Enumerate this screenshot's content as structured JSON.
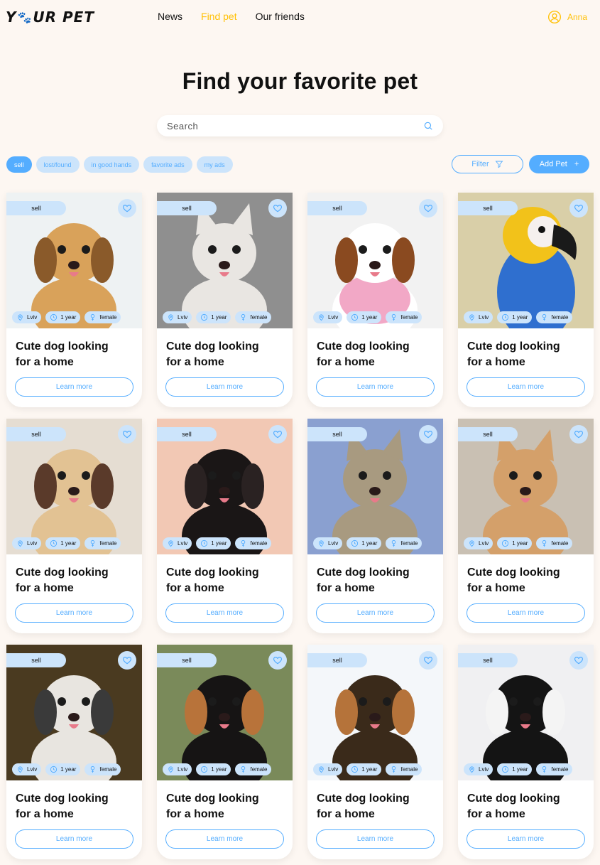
{
  "header": {
    "logo": {
      "pre": "Y",
      "post": "UR PET"
    },
    "nav": [
      {
        "label": "News",
        "active": false
      },
      {
        "label": "Find pet",
        "active": true
      },
      {
        "label": "Our friends",
        "active": false
      }
    ],
    "user_name": "Anna"
  },
  "page_title": "Find your favorite pet",
  "search": {
    "placeholder": "Search",
    "value": ""
  },
  "chips": [
    {
      "label": "sell",
      "active": true
    },
    {
      "label": "lost/found",
      "active": false
    },
    {
      "label": "in good hands",
      "active": false
    },
    {
      "label": "favorite ads",
      "active": false
    },
    {
      "label": "my ads",
      "active": false
    }
  ],
  "actions": {
    "filter_label": "Filter",
    "add_pet_label": "Add Pet",
    "add_icon": "+"
  },
  "colors": {
    "accent_blue": "#54adff",
    "light_blue": "#cce4fb",
    "accent_yellow": "#ffc107",
    "background": "#fdf7f2"
  },
  "cards": [
    {
      "category": "sell",
      "location": "Lviv",
      "age": "1 year",
      "sex": "female",
      "title_line1": "Cute dog looking",
      "title_line2": "for a home",
      "button": "Learn more",
      "photo": "golden-retriever-puppy"
    },
    {
      "category": "sell",
      "location": "Lviv",
      "age": "1 year",
      "sex": "female",
      "title_line1": "Cute dog looking",
      "title_line2": "for a home",
      "button": "Learn more",
      "photo": "white-cat"
    },
    {
      "category": "sell",
      "location": "Lviv",
      "age": "1 year",
      "sex": "female",
      "title_line1": "Cute dog looking",
      "title_line2": "for a home",
      "button": "Learn more",
      "photo": "cavalier-puppy"
    },
    {
      "category": "sell",
      "location": "Lviv",
      "age": "1 year",
      "sex": "female",
      "title_line1": "Cute dog looking",
      "title_line2": "for a home",
      "button": "Learn more",
      "photo": "macaw-parrot"
    },
    {
      "category": "sell",
      "location": "Lviv",
      "age": "1 year",
      "sex": "female",
      "title_line1": "Cute dog looking",
      "title_line2": "for a home",
      "button": "Learn more",
      "photo": "poodle"
    },
    {
      "category": "sell",
      "location": "Lviv",
      "age": "1 year",
      "sex": "female",
      "title_line1": "Cute dog looking",
      "title_line2": "for a home",
      "button": "Learn more",
      "photo": "black-staffy"
    },
    {
      "category": "sell",
      "location": "Lviv",
      "age": "1 year",
      "sex": "female",
      "title_line1": "Cute dog looking",
      "title_line2": "for a home",
      "button": "Learn more",
      "photo": "tabby-cat"
    },
    {
      "category": "sell",
      "location": "Lviv",
      "age": "1 year",
      "sex": "female",
      "title_line1": "Cute dog looking",
      "title_line2": "for a home",
      "button": "Learn more",
      "photo": "orange-maine-coon"
    },
    {
      "category": "sell",
      "location": "Lviv",
      "age": "1 year",
      "sex": "female",
      "title_line1": "Cute dog looking",
      "title_line2": "for a home",
      "button": "Learn more",
      "photo": "spitz"
    },
    {
      "category": "sell",
      "location": "Lviv",
      "age": "1 year",
      "sex": "female",
      "title_line1": "Cute dog looking",
      "title_line2": "for a home",
      "button": "Learn more",
      "photo": "bernese-mountain-dog"
    },
    {
      "category": "sell",
      "location": "Lviv",
      "age": "1 year",
      "sex": "female",
      "title_line1": "Cute dog looking",
      "title_line2": "for a home",
      "button": "Learn more",
      "photo": "shepherd-puppy"
    },
    {
      "category": "sell",
      "location": "Lviv",
      "age": "1 year",
      "sex": "female",
      "title_line1": "Cute dog looking",
      "title_line2": "for a home",
      "button": "Learn more",
      "photo": "husky-puppy"
    }
  ]
}
